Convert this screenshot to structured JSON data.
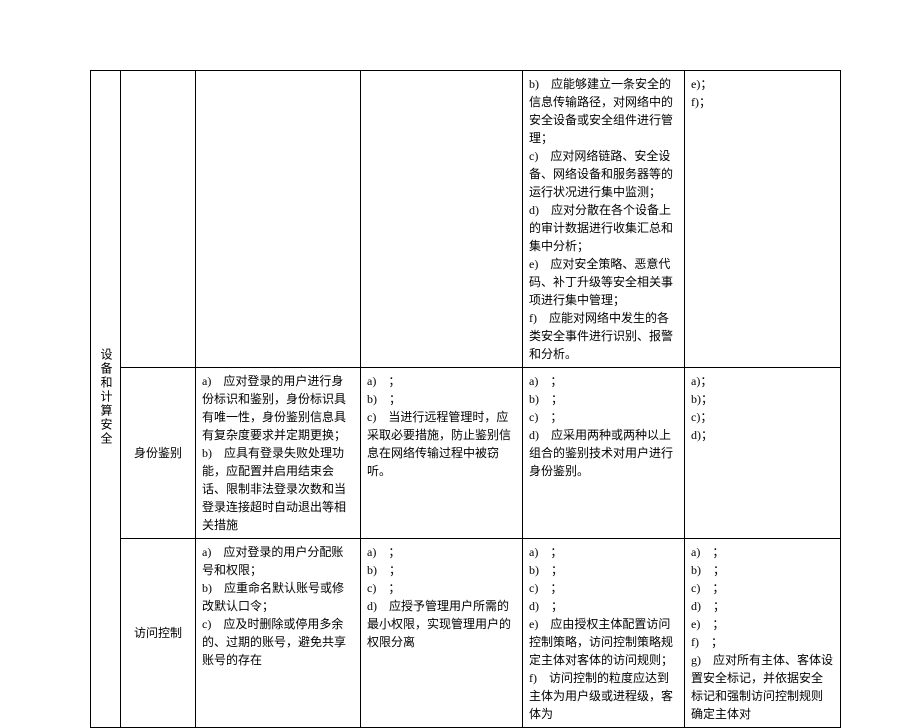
{
  "category_main": "设备和计算安全",
  "row_top": {
    "col4": "b)　应能够建立一条安全的信息传输路径，对网络中的安全设备或安全组件进行管理；\nc)　应对网络链路、安全设备、网络设备和服务器等的运行状况进行集中监测；\nd)　应对分散在各个设备上的审计数据进行收集汇总和集中分析；\ne)　应对安全策略、恶意代码、补丁升级等安全相关事项进行集中管理；\nf)　应能对网络中发生的各类安全事件进行识别、报警和分析。",
    "col5": "e)；\nf)；"
  },
  "row_identity": {
    "label": "身份鉴别",
    "col2": "a)　应对登录的用户进行身份标识和鉴别，身份标识具有唯一性，身份鉴别信息具有复杂度要求并定期更换；\nb)　应具有登录失败处理功能，应配置并启用结束会话、限制非法登录次数和当登录连接超时自动退出等相关措施",
    "col3": "a)　；\nb)　；\nc)　当进行远程管理时，应采取必要措施，防止鉴别信息在网络传输过程中被窃听。",
    "col4": "a)　；\nb)　；\nc)　；\nd)　应采用两种或两种以上组合的鉴别技术对用户进行身份鉴别。",
    "col5": "a)；\nb)；\nc)；\nd)；"
  },
  "row_access": {
    "label": "访问控制",
    "col2": "a)　应对登录的用户分配账号和权限；\nb)　应重命名默认账号或修改默认口令；\nc)　应及时删除或停用多余的、过期的账号，避免共享账号的存在",
    "col3": "a)　；\nb)　；\nc)　；\nd)　应授予管理用户所需的最小权限，实现管理用户的权限分离",
    "col4": "a)　；\nb)　；\nc)　；\nd)　；\ne)　应由授权主体配置访问控制策略，访问控制策略规定主体对客体的访问规则；\nf)　访问控制的粒度应达到主体为用户级或进程级，客体为",
    "col5": "a)　；\nb)　；\nc)　；\nd)　；\ne)　；\nf)　；\ng)　应对所有主体、客体设置安全标记，并依据安全标记和强制访问控制规则确定主体对"
  }
}
